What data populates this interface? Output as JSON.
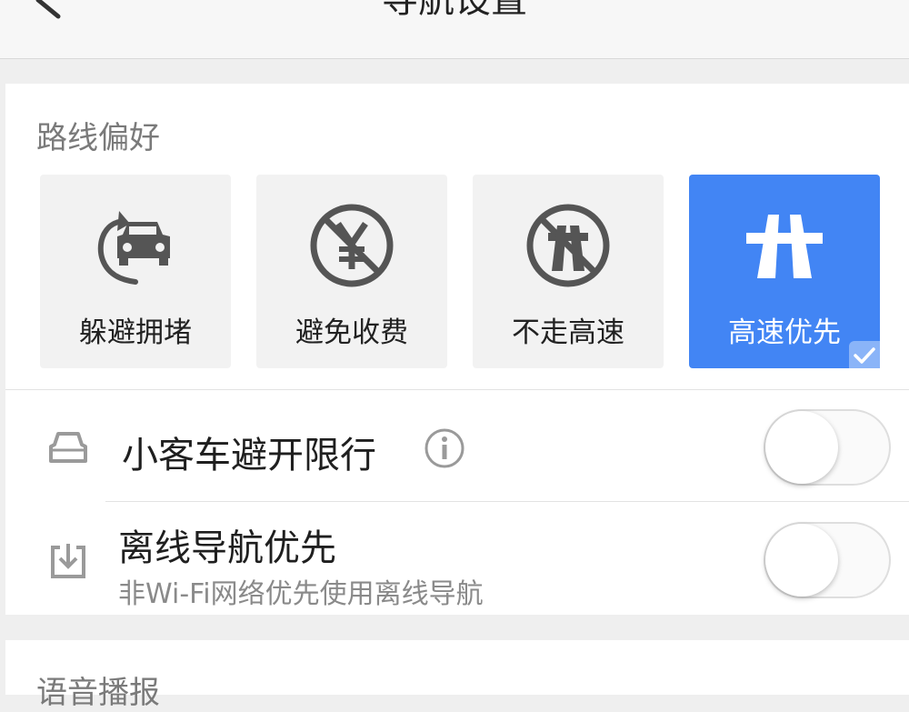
{
  "header": {
    "title": "导航设置",
    "back_icon": "chevron-left-icon"
  },
  "route_preference": {
    "label": "路线偏好",
    "options": [
      {
        "label": "躲避拥堵",
        "icon": "avoid-congestion-icon",
        "selected": false
      },
      {
        "label": "避免收费",
        "icon": "no-toll-icon",
        "selected": false
      },
      {
        "label": "不走高速",
        "icon": "no-highway-icon",
        "selected": false
      },
      {
        "label": "高速优先",
        "icon": "highway-icon",
        "selected": true
      }
    ],
    "accent_color": "#4285f4"
  },
  "settings": {
    "car_restriction": {
      "title": "小客车避开限行",
      "icon": "car-icon",
      "info_icon": "info-icon",
      "enabled": false
    },
    "offline_nav": {
      "title": "离线导航优先",
      "subtitle": "非Wi-Fi网络优先使用离线导航",
      "icon": "download-icon",
      "enabled": false
    }
  },
  "voice": {
    "label": "语音播报"
  }
}
